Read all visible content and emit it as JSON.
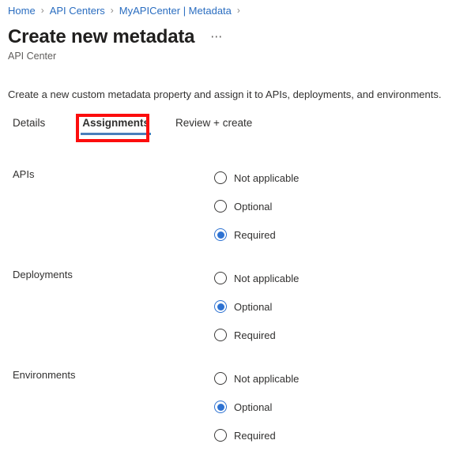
{
  "breadcrumb": {
    "separator": "›",
    "items": [
      {
        "label": "Home"
      },
      {
        "label": "API Centers"
      },
      {
        "label": "MyAPICenter | Metadata"
      }
    ]
  },
  "header": {
    "title": "Create new metadata",
    "more_label": "⋯",
    "subtitle": "API Center"
  },
  "description": "Create a new custom metadata property and assign it to APIs, deployments, and environments.",
  "tabs": [
    {
      "label": "Details",
      "selected": false
    },
    {
      "label": "Assignments",
      "selected": true
    },
    {
      "label": "Review + create",
      "selected": false
    }
  ],
  "colors": {
    "accent": "#2d72d2",
    "tab_underline": "#4a7ebb",
    "link": "#2a6dc0",
    "annotation": "#fc0d0d",
    "text": "#323130",
    "muted": "#605e5c"
  },
  "sections": [
    {
      "label": "APIs",
      "selected": "Required",
      "options": [
        {
          "label": "Not applicable",
          "selected": false
        },
        {
          "label": "Optional",
          "selected": false
        },
        {
          "label": "Required",
          "selected": true
        }
      ]
    },
    {
      "label": "Deployments",
      "selected": "Optional",
      "options": [
        {
          "label": "Not applicable",
          "selected": false
        },
        {
          "label": "Optional",
          "selected": true
        },
        {
          "label": "Required",
          "selected": false
        }
      ]
    },
    {
      "label": "Environments",
      "selected": "Optional",
      "options": [
        {
          "label": "Not applicable",
          "selected": false
        },
        {
          "label": "Optional",
          "selected": true
        },
        {
          "label": "Required",
          "selected": false
        }
      ]
    }
  ]
}
